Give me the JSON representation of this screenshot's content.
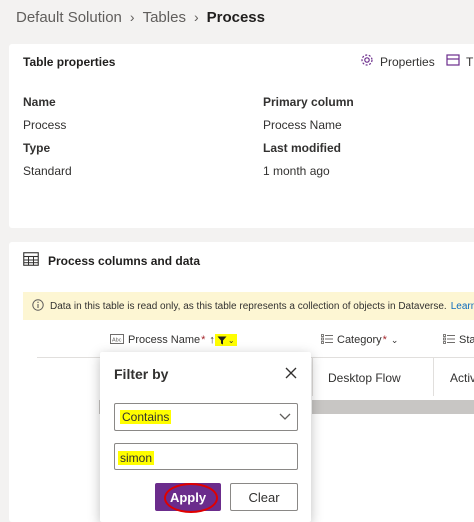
{
  "breadcrumb": {
    "items": [
      "Default Solution",
      "Tables"
    ],
    "current": "Process"
  },
  "table_properties": {
    "title": "Table properties",
    "actions": [
      "Properties",
      "T"
    ],
    "fields": [
      {
        "label": "Name",
        "value": "Process"
      },
      {
        "label": "Type",
        "value": "Standard"
      },
      {
        "label": "Primary column",
        "value": "Process Name"
      },
      {
        "label": "Last modified",
        "value": "1 month ago"
      }
    ]
  },
  "data_section": {
    "title": "Process columns and data",
    "banner_text": "Data in this table is read only, as this table represents a collection of objects in Dataverse.",
    "banner_link": "Learn",
    "columns": [
      {
        "label": "Process Name",
        "required_mark": "*"
      },
      {
        "label": "Category",
        "required_mark": "*"
      },
      {
        "label": "Sta"
      }
    ],
    "row_cells": [
      "Desktop Flow",
      "Activ"
    ]
  },
  "filter_popup": {
    "title": "Filter by",
    "operator": "Contains",
    "value": "simon",
    "apply_label": "Apply",
    "clear_label": "Clear"
  },
  "colors": {
    "accent": "#6b2c8c",
    "highlight": "#fffe00",
    "annotation": "#e00000",
    "banner": "#fdf6d3"
  }
}
